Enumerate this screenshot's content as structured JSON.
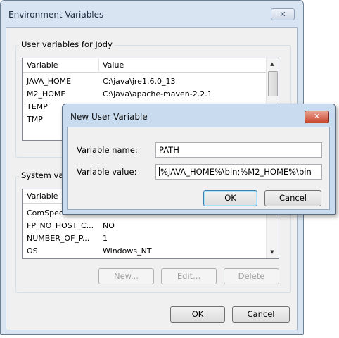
{
  "env": {
    "title": "Environment Variables",
    "close_icon": "✕",
    "user_group_label": "User variables for Jody",
    "system_group_label": "System variables",
    "columns": [
      "Variable",
      "Value"
    ],
    "user_rows": [
      {
        "name": "JAVA_HOME",
        "value": "C:\\java\\jre1.6.0_13"
      },
      {
        "name": "M2_HOME",
        "value": "C:\\java\\apache-maven-2.2.1"
      },
      {
        "name": "TEMP",
        "value": ""
      },
      {
        "name": "TMP",
        "value": ""
      }
    ],
    "system_rows": [
      {
        "name": "ComSpec",
        "value": ""
      },
      {
        "name": "FP_NO_HOST_C...",
        "value": "NO"
      },
      {
        "name": "NUMBER_OF_P...",
        "value": "1"
      },
      {
        "name": "OS",
        "value": "Windows_NT"
      }
    ],
    "buttons": {
      "new": "New...",
      "edit": "Edit...",
      "delete": "Delete"
    },
    "ok": "OK",
    "cancel": "Cancel"
  },
  "dialog": {
    "title": "New User Variable",
    "close_icon": "✕",
    "name_label": "Variable name:",
    "name_value": "PATH",
    "value_label": "Variable value:",
    "value_value": "%JAVA_HOME%\\bin;%M2_HOME%\\bin",
    "ok": "OK",
    "cancel": "Cancel"
  },
  "colors": {
    "window_frame": "#d8e4f1",
    "dialog_frame": "#c9dbee",
    "close_red": "#c9482f"
  }
}
